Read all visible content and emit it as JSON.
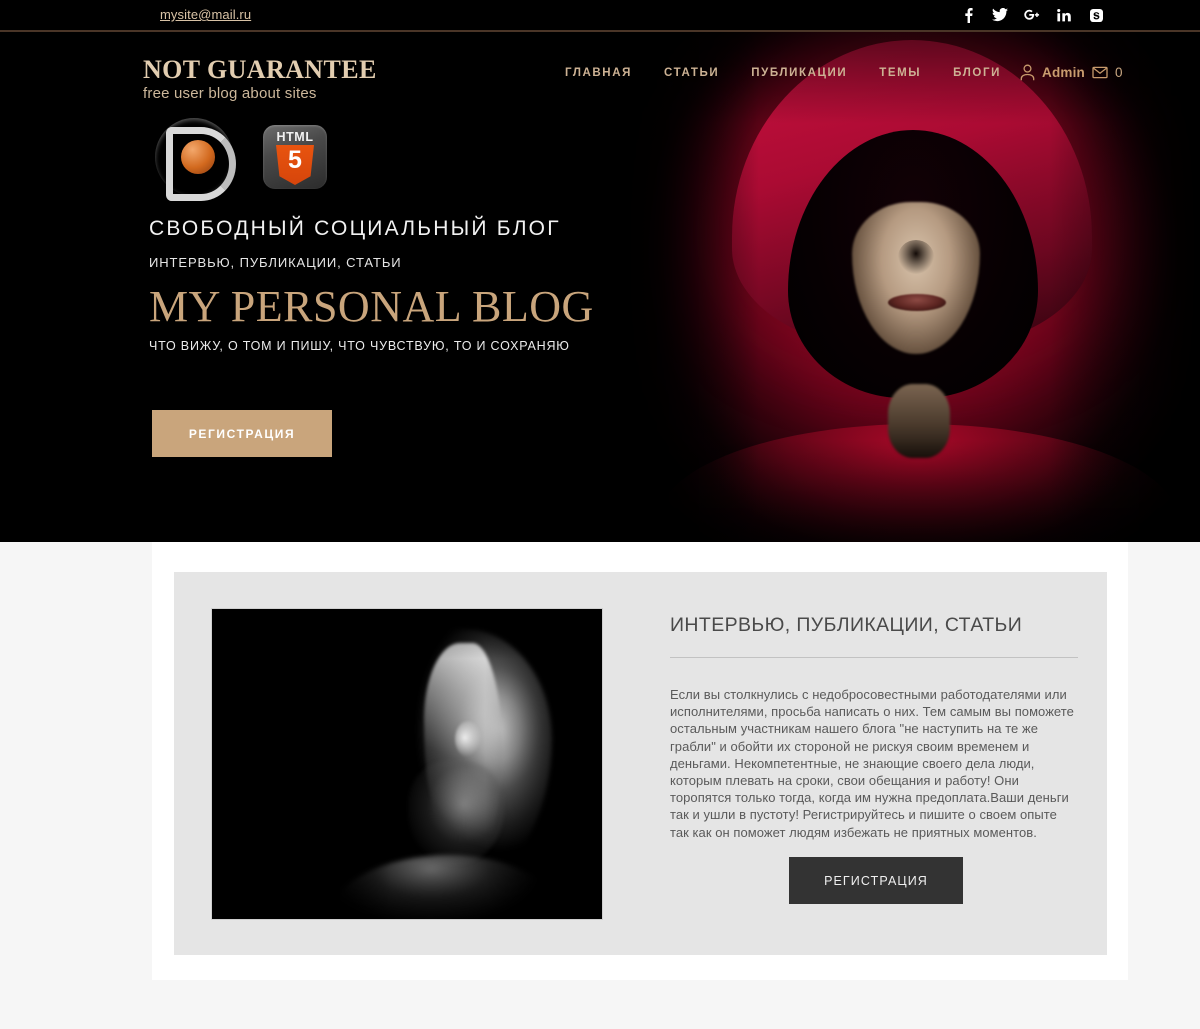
{
  "topbar": {
    "email": "mysite@mail.ru",
    "social": [
      {
        "name": "facebook-icon",
        "label": "f"
      },
      {
        "name": "twitter-icon",
        "label": "t"
      },
      {
        "name": "google-plus-icon",
        "label": "g+"
      },
      {
        "name": "linkedin-icon",
        "label": "in"
      },
      {
        "name": "skype-icon",
        "label": "s"
      }
    ]
  },
  "brand": {
    "title": "NOT GUARANTEE",
    "subtitle": "free user blog about sites"
  },
  "nav": {
    "items": [
      {
        "label": "ГЛАВНАЯ"
      },
      {
        "label": "СТАТЬИ"
      },
      {
        "label": "ПУБЛИКАЦИИ"
      },
      {
        "label": "ТЕМЫ"
      },
      {
        "label": "БЛОГИ"
      }
    ]
  },
  "user": {
    "name": "Admin",
    "message_count": "0"
  },
  "badges": [
    {
      "name": "d-logo-badge",
      "label": "D"
    },
    {
      "name": "html5-badge",
      "word": "HTML",
      "digit": "5"
    }
  ],
  "hero": {
    "kicker": "СВОБОДНЫЙ  СОЦИАЛЬНЫЙ  БЛОГ",
    "subtitle": "ИНТЕРВЬЮ, ПУБЛИКАЦИИ, СТАТЬИ",
    "title": "MY PERSONAL BLOG",
    "tagline": "ЧТО ВИЖУ, О ТОМ И ПИШУ,  ЧТО ЧУВСТВУЮ,  ТО И СОХРАНЯЮ",
    "button_label": "РЕГИСТРАЦИЯ",
    "image_alt": "hooded-figure-in-red-hood"
  },
  "content": {
    "image_alt": "black-and-white-profile-portrait-of-bearded-man",
    "title": "ИНТЕРВЬЮ, ПУБЛИКАЦИИ, СТАТЬИ",
    "paragraph": "Если вы столкнулись с недобросовестными работодателями или исполнителями, просьба написать о них. Тем  самым вы поможете остальным участникам нашего блога \"не наступить на те же грабли\" и обойти их стороной не рискуя своим временем и деньгами. Некомпетентные, не знающие своего дела люди, которым плевать на сроки, свои обещания и работу! Они торопятся только тогда, когда им нужна предоплата.Ваши деньги так и ушли в пустоту! Регистрируйтесь и пишите о своем опыте так как он поможет людям избежать не приятных моментов.",
    "button_label": "РЕГИСТРАЦИЯ"
  },
  "colors": {
    "accent_tan": "#c9a57c",
    "brand_gold": "#e2cdb0",
    "nav_link": "#cdb294",
    "topbar_bg": "#000000",
    "divider": "#4a3527",
    "page_bg": "#f6f6f6",
    "card_bg": "#e5e5e5",
    "dark_button": "#333333",
    "hood_red": "#b5092a"
  }
}
